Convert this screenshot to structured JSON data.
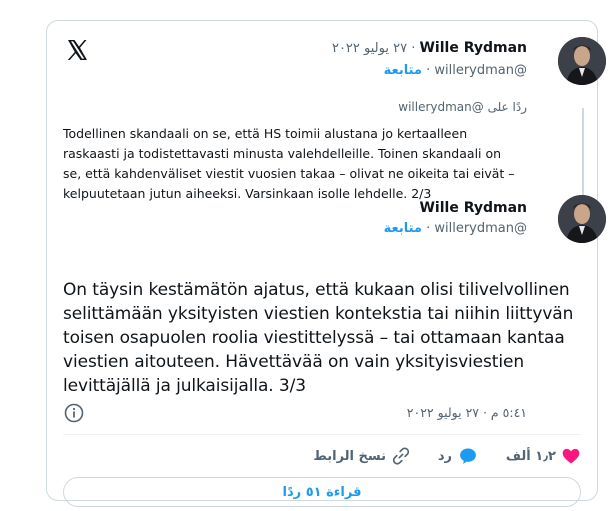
{
  "quoted_tweet": {
    "author_name": "Wille Rydman",
    "date": "٢٧ يوليو ٢٠٢٢",
    "handle": "@willerydman",
    "follow_label": "متابعة",
    "reply_to_label": "ردًا على",
    "reply_to_handle": "@willerydman",
    "text": "Todellinen skandaali on se, että HS toimii alustana jo kertaalleen raskaasti ja todistettavasti minusta valehdelleille. Toinen skandaali on se, että kahdenväliset viestit vuosien takaa – olivat ne oikeita tai eivät – kelpuutetaan jutun aiheeksi. Varsinkaan isolle lehdelle. 2/3"
  },
  "main_tweet": {
    "author_name": "Wille Rydman",
    "handle": "@willerydman",
    "follow_label": "متابعة",
    "text": "On täysin kestämätön ajatus, että kukaan olisi tilivelvollinen selittämään yksityisten viestien kontekstia tai niihin liittyvän toisen osapuolen roolia viestittelyssä – tai ottamaan kantaa viestien aitouteen. Hävettävää on vain yksityisviestien levittäjällä ja julkaisijalla. 3/3",
    "timestamp": "٥:٤١ م · ٢٧ يوليو ٢٠٢٢"
  },
  "actions": {
    "likes_count": "١٫٢ ألف",
    "reply_label": "رد",
    "copy_link_label": "نسخ الرابط"
  },
  "read_replies_label": "قراءة ٥١ ردًا",
  "colors": {
    "accent": "#1d9bf0",
    "like": "#f91880",
    "text": "#0f1419",
    "muted": "#536471",
    "border": "#cfd9de"
  },
  "icons": [
    "x-logo-icon",
    "info-icon",
    "heart-icon",
    "reply-bubble-icon",
    "link-icon"
  ]
}
